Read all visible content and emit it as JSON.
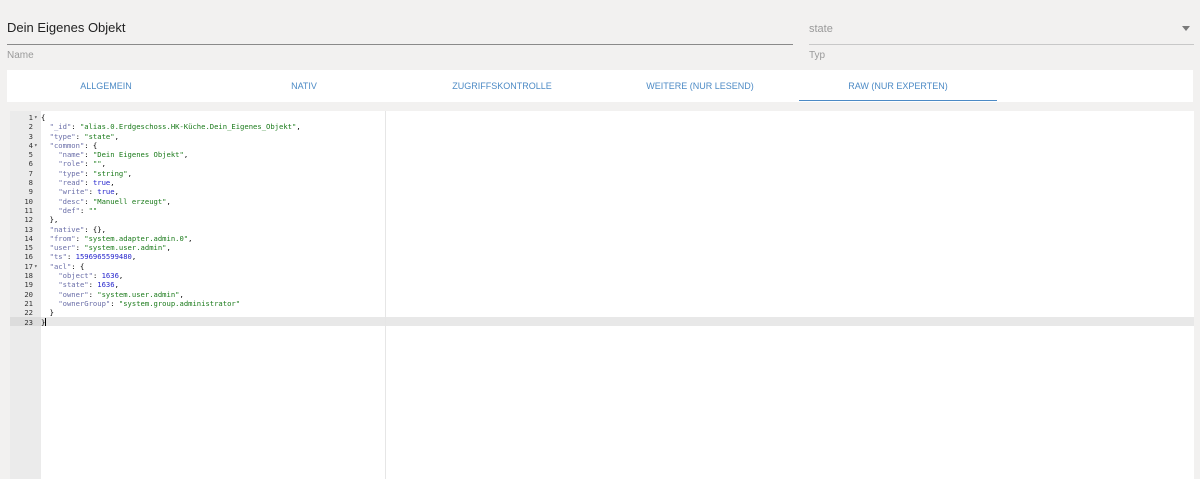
{
  "name_field": {
    "value": "Dein Eigenes Objekt",
    "label": "Name"
  },
  "type_field": {
    "value": "state",
    "label": "Typ"
  },
  "tabs": [
    {
      "label": "ALLGEMEIN"
    },
    {
      "label": "NATIV"
    },
    {
      "label": "ZUGRIFFSKONTROLLE"
    },
    {
      "label": "WEITERE (NUR LESEND)"
    },
    {
      "label": "RAW (NUR EXPERTEN)",
      "active": true
    }
  ],
  "editor": {
    "active_line": 23,
    "lines": [
      {
        "n": "1",
        "fold": true,
        "tokens": [
          [
            "p",
            "{"
          ]
        ]
      },
      {
        "n": "2",
        "tokens": [
          [
            "p",
            "  "
          ],
          [
            "k",
            "\"_id\""
          ],
          [
            "p",
            ": "
          ],
          [
            "s",
            "\"alias.0.Erdgeschoss.HK-Küche.Dein_Eigenes_Objekt\""
          ],
          [
            "p",
            ","
          ]
        ]
      },
      {
        "n": "3",
        "tokens": [
          [
            "p",
            "  "
          ],
          [
            "k",
            "\"type\""
          ],
          [
            "p",
            ": "
          ],
          [
            "s",
            "\"state\""
          ],
          [
            "p",
            ","
          ]
        ]
      },
      {
        "n": "4",
        "fold": true,
        "tokens": [
          [
            "p",
            "  "
          ],
          [
            "k",
            "\"common\""
          ],
          [
            "p",
            ": {"
          ]
        ]
      },
      {
        "n": "5",
        "tokens": [
          [
            "p",
            "    "
          ],
          [
            "k",
            "\"name\""
          ],
          [
            "p",
            ": "
          ],
          [
            "s",
            "\"Dein Eigenes Objekt\""
          ],
          [
            "p",
            ","
          ]
        ]
      },
      {
        "n": "6",
        "tokens": [
          [
            "p",
            "    "
          ],
          [
            "k",
            "\"role\""
          ],
          [
            "p",
            ": "
          ],
          [
            "s",
            "\"\""
          ],
          [
            "p",
            ","
          ]
        ]
      },
      {
        "n": "7",
        "tokens": [
          [
            "p",
            "    "
          ],
          [
            "k",
            "\"type\""
          ],
          [
            "p",
            ": "
          ],
          [
            "s",
            "\"string\""
          ],
          [
            "p",
            ","
          ]
        ]
      },
      {
        "n": "8",
        "tokens": [
          [
            "p",
            "    "
          ],
          [
            "k",
            "\"read\""
          ],
          [
            "p",
            ": "
          ],
          [
            "b",
            "true"
          ],
          [
            "p",
            ","
          ]
        ]
      },
      {
        "n": "9",
        "tokens": [
          [
            "p",
            "    "
          ],
          [
            "k",
            "\"write\""
          ],
          [
            "p",
            ": "
          ],
          [
            "b",
            "true"
          ],
          [
            "p",
            ","
          ]
        ]
      },
      {
        "n": "10",
        "tokens": [
          [
            "p",
            "    "
          ],
          [
            "k",
            "\"desc\""
          ],
          [
            "p",
            ": "
          ],
          [
            "s",
            "\"Manuell erzeugt\""
          ],
          [
            "p",
            ","
          ]
        ]
      },
      {
        "n": "11",
        "tokens": [
          [
            "p",
            "    "
          ],
          [
            "k",
            "\"def\""
          ],
          [
            "p",
            ": "
          ],
          [
            "s",
            "\"\""
          ]
        ]
      },
      {
        "n": "12",
        "tokens": [
          [
            "p",
            "  },"
          ]
        ]
      },
      {
        "n": "13",
        "tokens": [
          [
            "p",
            "  "
          ],
          [
            "k",
            "\"native\""
          ],
          [
            "p",
            ": {},"
          ]
        ]
      },
      {
        "n": "14",
        "tokens": [
          [
            "p",
            "  "
          ],
          [
            "k",
            "\"from\""
          ],
          [
            "p",
            ": "
          ],
          [
            "s",
            "\"system.adapter.admin.0\""
          ],
          [
            "p",
            ","
          ]
        ]
      },
      {
        "n": "15",
        "tokens": [
          [
            "p",
            "  "
          ],
          [
            "k",
            "\"user\""
          ],
          [
            "p",
            ": "
          ],
          [
            "s",
            "\"system.user.admin\""
          ],
          [
            "p",
            ","
          ]
        ]
      },
      {
        "n": "16",
        "tokens": [
          [
            "p",
            "  "
          ],
          [
            "k",
            "\"ts\""
          ],
          [
            "p",
            ": "
          ],
          [
            "n",
            "1596965599480"
          ],
          [
            "p",
            ","
          ]
        ]
      },
      {
        "n": "17",
        "fold": true,
        "tokens": [
          [
            "p",
            "  "
          ],
          [
            "k",
            "\"acl\""
          ],
          [
            "p",
            ": {"
          ]
        ]
      },
      {
        "n": "18",
        "tokens": [
          [
            "p",
            "    "
          ],
          [
            "k",
            "\"object\""
          ],
          [
            "p",
            ": "
          ],
          [
            "n",
            "1636"
          ],
          [
            "p",
            ","
          ]
        ]
      },
      {
        "n": "19",
        "tokens": [
          [
            "p",
            "    "
          ],
          [
            "k",
            "\"state\""
          ],
          [
            "p",
            ": "
          ],
          [
            "n",
            "1636"
          ],
          [
            "p",
            ","
          ]
        ]
      },
      {
        "n": "20",
        "tokens": [
          [
            "p",
            "    "
          ],
          [
            "k",
            "\"owner\""
          ],
          [
            "p",
            ": "
          ],
          [
            "s",
            "\"system.user.admin\""
          ],
          [
            "p",
            ","
          ]
        ]
      },
      {
        "n": "21",
        "tokens": [
          [
            "p",
            "    "
          ],
          [
            "k",
            "\"ownerGroup\""
          ],
          [
            "p",
            ": "
          ],
          [
            "s",
            "\"system.group.administrator\""
          ]
        ]
      },
      {
        "n": "22",
        "tokens": [
          [
            "p",
            "  }"
          ]
        ]
      },
      {
        "n": "23",
        "cursor": true,
        "tokens": [
          [
            "p",
            "}"
          ]
        ]
      }
    ]
  }
}
